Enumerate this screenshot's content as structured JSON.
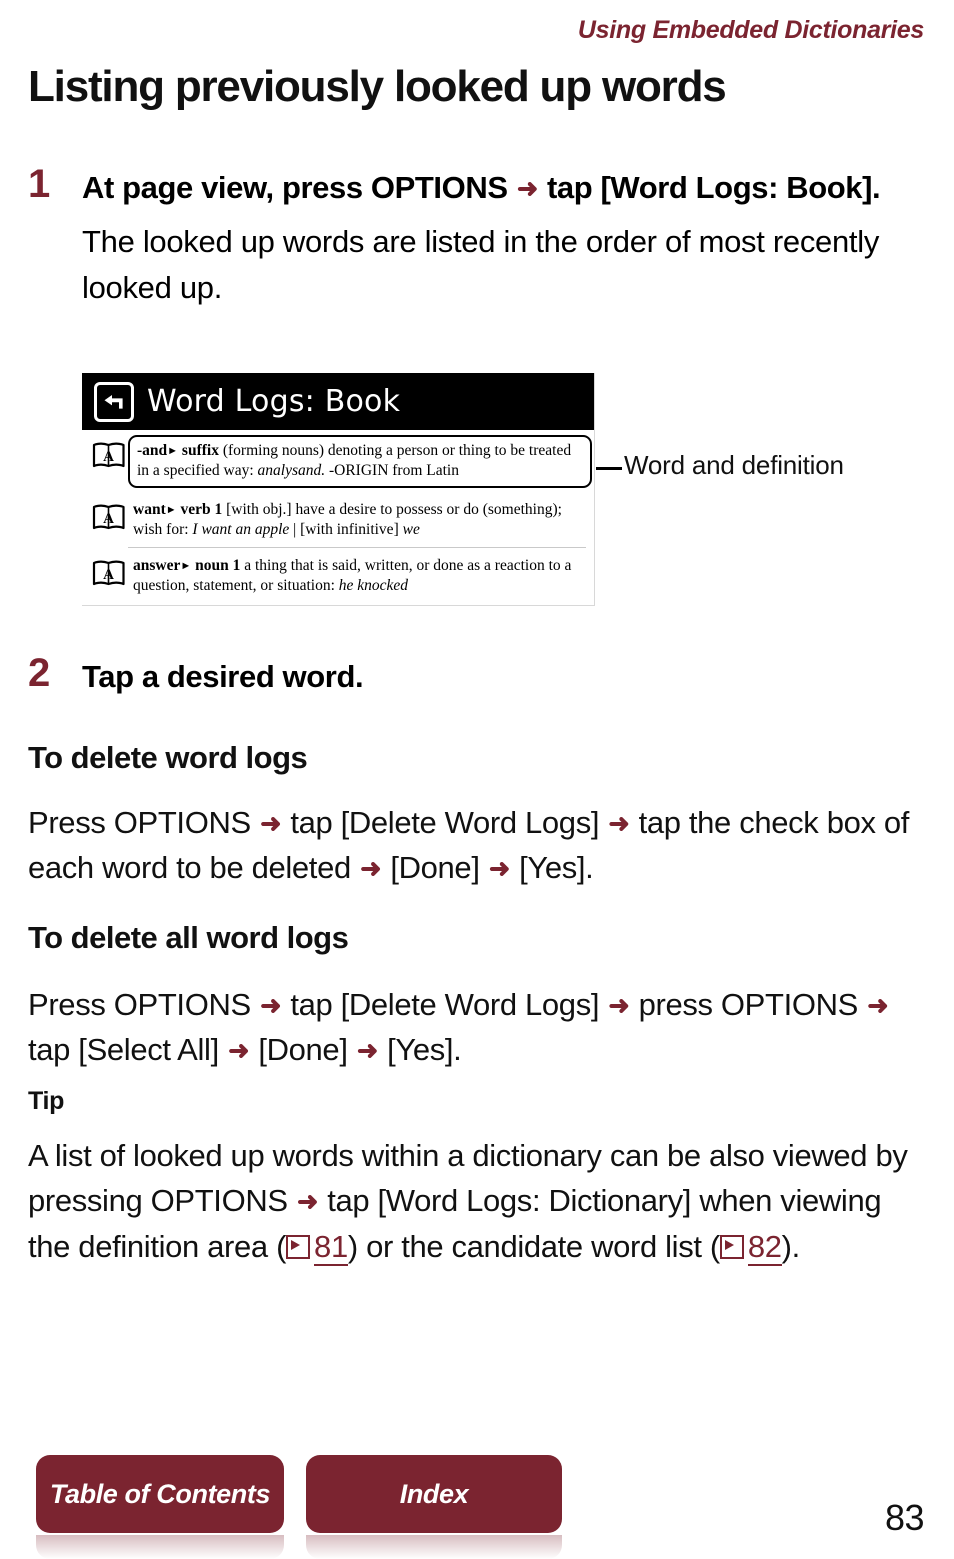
{
  "header": {
    "running_title": "Using Embedded Dictionaries",
    "title": "Listing previously looked up words",
    "accent_color": "#7B2430"
  },
  "steps": [
    {
      "number": "1",
      "heading_before_arrow": "At page view, press OPTIONS",
      "heading_after_arrow": "tap [Word Logs: Book].",
      "body": "The looked up words are listed in the order of most recently looked up."
    },
    {
      "number": "2",
      "heading": "Tap a desired word."
    }
  ],
  "device_screenshot": {
    "back_icon": "back-arrow-icon",
    "title": "Word Logs: Book",
    "entries": [
      {
        "icon": "book-a-icon",
        "headword": "-and",
        "pos": "suffix",
        "sense_number": "",
        "definition_1": " (forming nouns) denoting a person or thing to be treated in a specified way: ",
        "example": "analysand.",
        "definition_2": "  -ORIGIN from Latin",
        "highlighted": true
      },
      {
        "icon": "book-a-icon",
        "headword": "want",
        "pos": "verb",
        "sense_number": "1",
        "definition_1": " [with obj.] have a desire to possess or do (something); wish for: ",
        "example": "I want an apple",
        "definition_2": "  |  [with infinitive] ",
        "example_2": "we",
        "highlighted": false
      },
      {
        "icon": "book-a-icon",
        "headword": "answer",
        "pos": "noun",
        "sense_number": "1",
        "definition_1": " a thing that is said, written, or done as a reaction to a question, statement, or situation: ",
        "example": "he knocked",
        "definition_2": "",
        "highlighted": false
      }
    ]
  },
  "callout": {
    "label": "Word and definition"
  },
  "sections": [
    {
      "heading": "To delete word logs",
      "body_parts": [
        "Press OPTIONS",
        "tap [Delete Word Logs]",
        "tap the check box of each word to be deleted",
        "[Done]",
        "[Yes]."
      ]
    },
    {
      "heading": "To delete all word logs",
      "body_parts": [
        "Press OPTIONS",
        "tap [Delete Word Logs]",
        "press OPTIONS",
        "tap [Select All]",
        "[Done]",
        "[Yes]."
      ]
    }
  ],
  "tip": {
    "heading": "Tip",
    "text_1": "A list of looked up words within a dictionary can be also viewed by pressing OPTIONS",
    "text_2": "tap [Word Logs: Dictionary] when viewing the definition area (",
    "page_ref_1": "81",
    "text_3": ") or the candidate word list (",
    "page_ref_2": "82",
    "text_4": ")."
  },
  "footer": {
    "toc_label": "Table of Contents",
    "index_label": "Index",
    "page_number": "83"
  },
  "icons": {
    "arrow": "➜"
  }
}
